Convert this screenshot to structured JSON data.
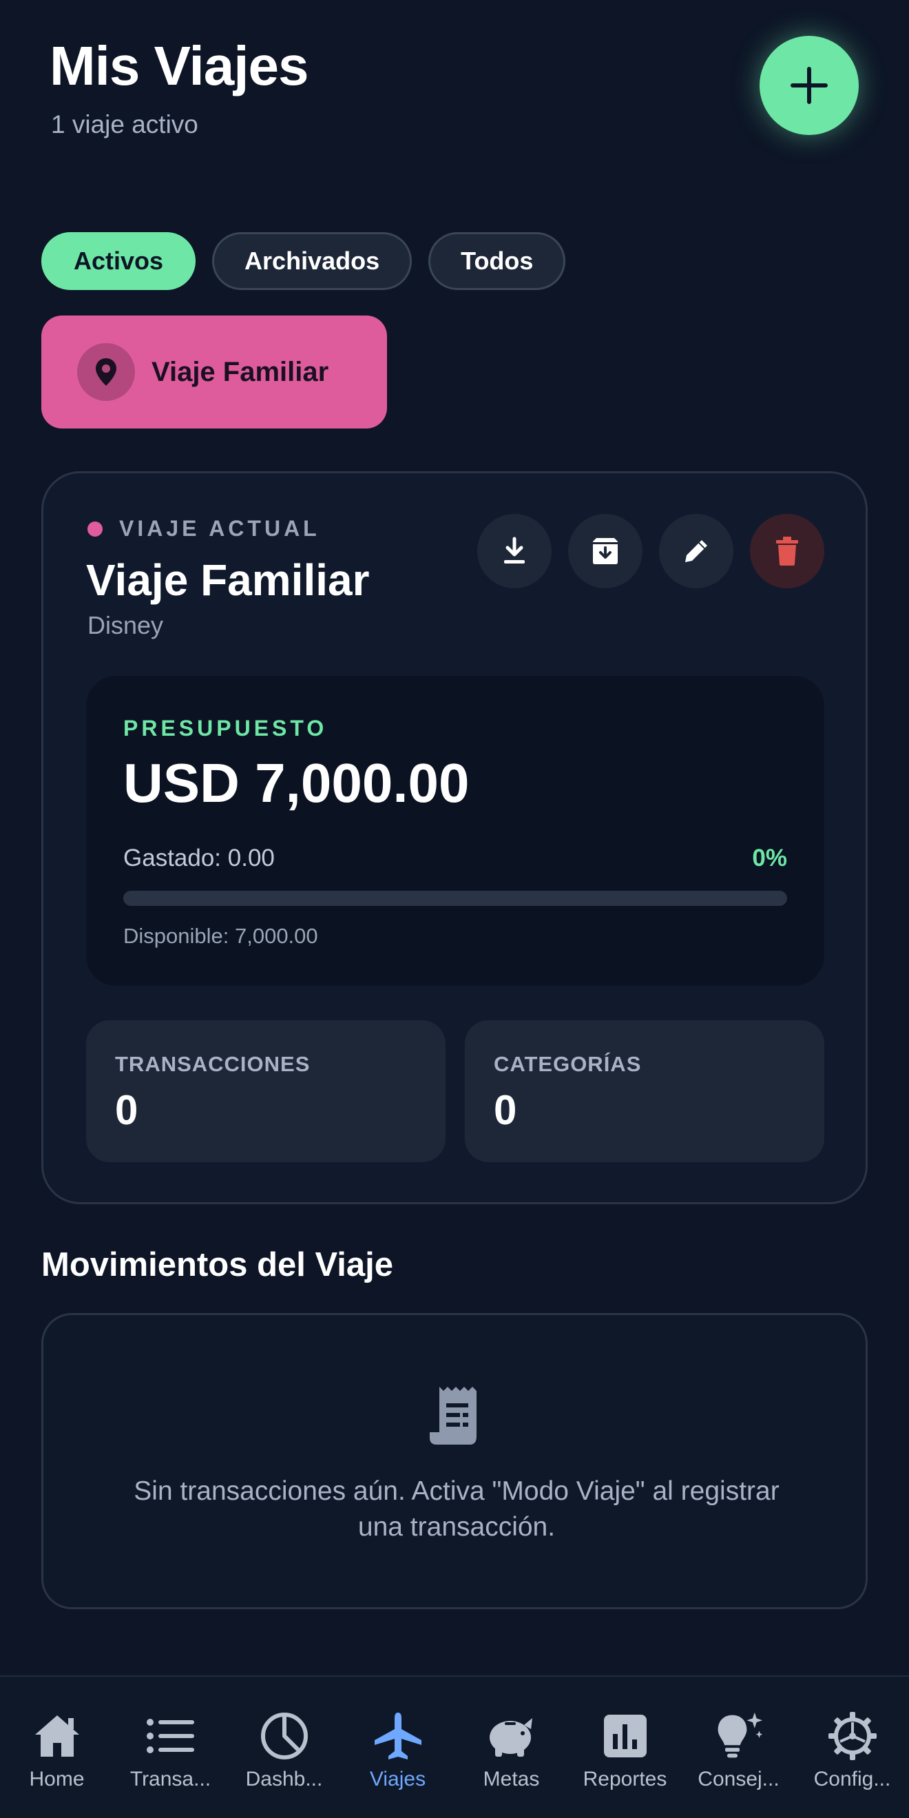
{
  "header": {
    "title": "Mis Viajes",
    "subtitle": "1 viaje activo",
    "add_icon": "plus-icon"
  },
  "filters": [
    {
      "label": "Activos",
      "active": true
    },
    {
      "label": "Archivados",
      "active": false
    },
    {
      "label": "Todos",
      "active": false
    }
  ],
  "trip_selector": {
    "label": "Viaje Familiar",
    "icon": "map-pin-icon"
  },
  "current_trip": {
    "eyebrow": "VIAJE ACTUAL",
    "name": "Viaje Familiar",
    "destination": "Disney",
    "actions": [
      {
        "name": "download",
        "icon": "download-icon"
      },
      {
        "name": "archive",
        "icon": "archive-icon"
      },
      {
        "name": "edit",
        "icon": "pencil-icon"
      },
      {
        "name": "delete",
        "icon": "trash-icon"
      }
    ],
    "budget": {
      "label": "PRESUPUESTO",
      "amount": "USD 7,000.00",
      "spent_text": "Gastado: 0.00",
      "percent_text": "0%",
      "progress_fraction": 0,
      "available_text": "Disponible: 7,000.00"
    },
    "stats": [
      {
        "label": "TRANSACCIONES",
        "value": "0"
      },
      {
        "label": "CATEGORÍAS",
        "value": "0"
      }
    ]
  },
  "movements": {
    "title": "Movimientos del Viaje",
    "empty_icon": "receipt-icon",
    "empty_message": "Sin transacciones aún. Activa \"Modo Viaje\" al registrar una transacción."
  },
  "bottom_nav": [
    {
      "label": "Home",
      "icon": "home-icon",
      "active": false
    },
    {
      "label": "Transa...",
      "icon": "list-icon",
      "active": false
    },
    {
      "label": "Dashb...",
      "icon": "pie-chart-icon",
      "active": false
    },
    {
      "label": "Viajes",
      "icon": "airplane-icon",
      "active": true
    },
    {
      "label": "Metas",
      "icon": "piggy-bank-icon",
      "active": false
    },
    {
      "label": "Reportes",
      "icon": "bar-chart-icon",
      "active": false
    },
    {
      "label": "Consej...",
      "icon": "lightbulb-icon",
      "active": false
    },
    {
      "label": "Config...",
      "icon": "gear-icon",
      "active": false
    }
  ],
  "colors": {
    "background": "#0d1526",
    "accent_green": "#6ee7a6",
    "accent_pink": "#df5c9c",
    "active_nav": "#6ea8ff",
    "danger": "#e0554f"
  }
}
